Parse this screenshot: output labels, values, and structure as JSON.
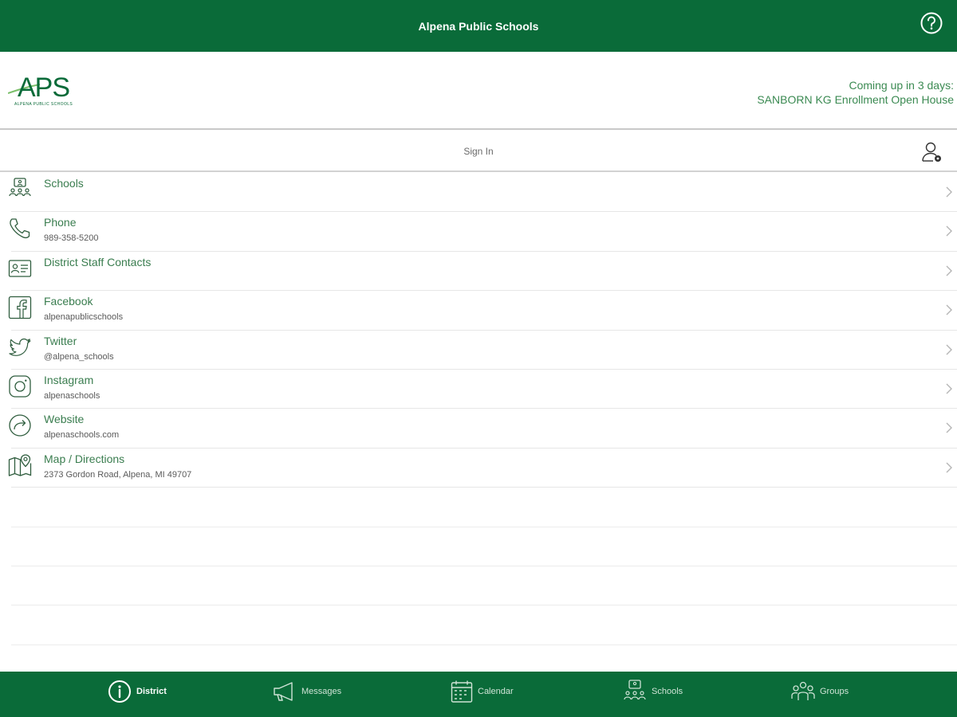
{
  "app": {
    "title": "Alpena Public Schools"
  },
  "header": {
    "logo_text": "APS",
    "logo_subtext": "ALPENA PUBLIC SCHOOLS",
    "upcoming_line1": "Coming up in 3 days:",
    "upcoming_line2": "SANBORN KG Enrollment Open House"
  },
  "signin": {
    "label": "Sign In"
  },
  "list": [
    {
      "title": "Schools",
      "subtitle": "",
      "icon": "schools-icon"
    },
    {
      "title": "Phone",
      "subtitle": "989-358-5200",
      "icon": "phone-icon"
    },
    {
      "title": "District Staff Contacts",
      "subtitle": "",
      "icon": "contact-card-icon"
    },
    {
      "title": "Facebook",
      "subtitle": "alpenapublicschools",
      "icon": "facebook-icon"
    },
    {
      "title": "Twitter",
      "subtitle": "@alpena_schools",
      "icon": "twitter-icon"
    },
    {
      "title": "Instagram",
      "subtitle": "alpenaschools",
      "icon": "instagram-icon"
    },
    {
      "title": "Website",
      "subtitle": "alpenaschools.com",
      "icon": "website-icon"
    },
    {
      "title": "Map / Directions",
      "subtitle": "2373 Gordon Road, Alpena, MI 49707",
      "icon": "map-icon"
    }
  ],
  "tabs": [
    {
      "label": "District",
      "icon": "info-icon",
      "active": true
    },
    {
      "label": "Messages",
      "icon": "megaphone-icon",
      "active": false
    },
    {
      "label": "Calendar",
      "icon": "calendar-icon",
      "active": false
    },
    {
      "label": "Schools",
      "icon": "schools-icon",
      "active": false
    },
    {
      "label": "Groups",
      "icon": "groups-icon",
      "active": false
    }
  ],
  "colors": {
    "brand": "#0a6b39",
    "text": "#3a7d4f",
    "muted": "#5a5a5a"
  }
}
